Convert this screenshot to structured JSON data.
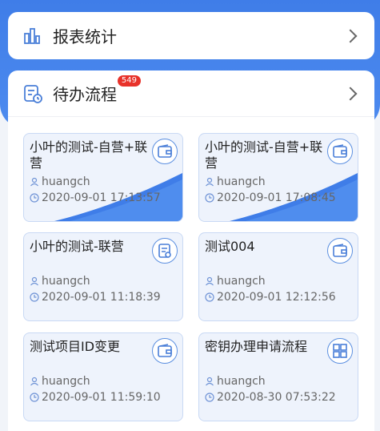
{
  "report": {
    "title": "报表统计"
  },
  "todo": {
    "title": "待办流程",
    "badge": "549"
  },
  "tiles": [
    {
      "name": "小叶的测试-自营+联营",
      "user": "huangch",
      "time": "2020-09-01 17:13:57",
      "icon": "wallet-icon",
      "highlight": true
    },
    {
      "name": "小叶的测试-自营+联营",
      "user": "huangch",
      "time": "2020-09-01 17:08:45",
      "icon": "wallet-icon",
      "highlight": true
    },
    {
      "name": "小叶的测试-联营",
      "user": "huangch",
      "time": "2020-09-01 11:18:39",
      "icon": "document-icon",
      "highlight": false
    },
    {
      "name": "测试004",
      "user": "huangch",
      "time": "2020-09-01 12:12:56",
      "icon": "wallet-icon",
      "highlight": false
    },
    {
      "name": "测试项目ID变更",
      "user": "huangch",
      "time": "2020-09-01 11:59:10",
      "icon": "wallet-icon",
      "highlight": false
    },
    {
      "name": "密钥办理申请流程",
      "user": "huangch",
      "time": "2020-08-30 07:53:22",
      "icon": "grid-icon",
      "highlight": false
    }
  ],
  "colors": {
    "primary": "#3f7de8",
    "badge": "#e8322a"
  }
}
